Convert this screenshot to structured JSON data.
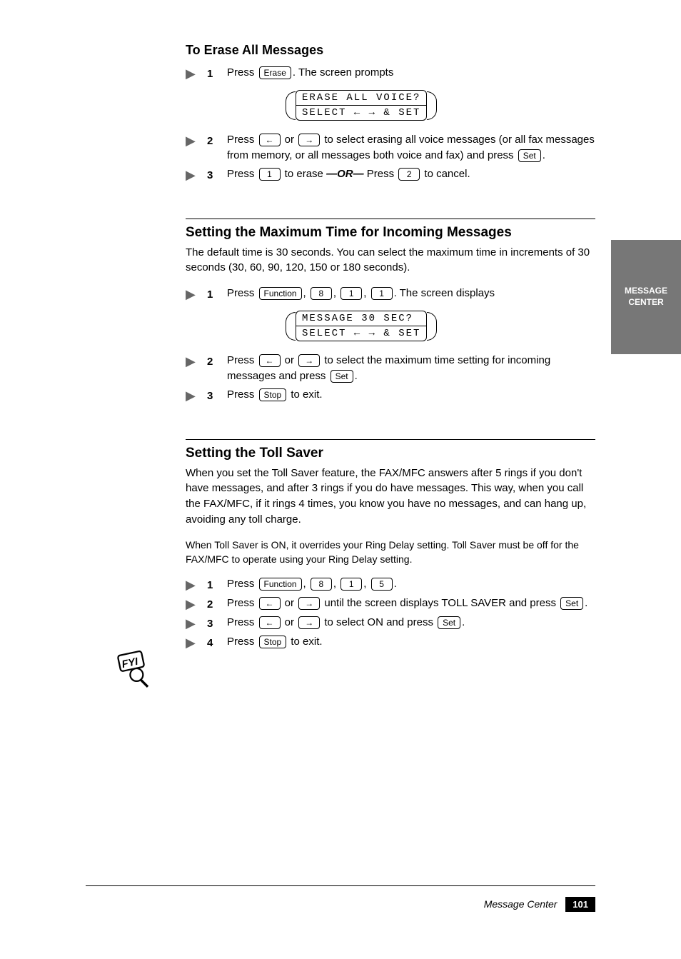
{
  "sideTab": "MESSAGE CENTER",
  "eraseAll": {
    "title": "To Erase All Messages",
    "step1": {
      "text_a": "Press ",
      "key1": "Erase",
      "text_b": ". The screen prompts"
    },
    "lcd": {
      "line1": "ERASE ALL VOICE?",
      "line2": "SELECT ← → & SET"
    },
    "step2": {
      "text_a": "Press ",
      "text_b": " or ",
      "text_c": " to select erasing all voice messages (or all fax messages from memory, or all messages both voice and fax) and press ",
      "key_set": "Set",
      "text_d": "."
    },
    "step3": {
      "text_a": "Press ",
      "key1": "1",
      "text_b": " to erase ",
      "or": "—OR—",
      "text_c": " Press ",
      "key2": "2",
      "text_d": " to cancel."
    }
  },
  "maxTime": {
    "title": "Setting the Maximum Time for Incoming Messages",
    "intro": "The default time is 30 seconds. You can select the maximum time in increments of 30 seconds (30, 60, 90, 120, 150 or 180 seconds).",
    "step1": {
      "text_a": "Press ",
      "key_fn": "Function",
      "key_8": "8",
      "key_1a": "1",
      "key_1b": "1",
      "text_b": ". The screen displays"
    },
    "lcd": {
      "line1": "MESSAGE 30 SEC?",
      "line2": "SELECT ← → & SET"
    },
    "step2": {
      "text_a": "Press ",
      "text_b": " or ",
      "text_c": " to select the maximum time setting for incoming messages and press ",
      "key_set": "Set",
      "text_d": "."
    },
    "step3": {
      "text_a": "Press ",
      "key_stop": "Stop",
      "text_b": " to exit."
    }
  },
  "tollSaver": {
    "title": "Setting the Toll Saver",
    "intro1": "When you set the Toll Saver feature, the FAX/MFC answers after 5 rings if you don't have messages, and after 3 rings if you do have messages. This way, when you call the FAX/MFC, if it rings 4 times, you know you have no messages, and can hang up, avoiding any toll charge.",
    "intro2": "When Toll Saver is ON, it overrides your Ring Delay setting. Toll Saver must be off for the FAX/MFC to operate using your Ring Delay setting.",
    "step1": {
      "text_a": "Press ",
      "key_fn": "Function",
      "key_8": "8",
      "key_1": "1",
      "key_5": "5",
      "text_b": "."
    },
    "step2": {
      "text_a": "Press ",
      "text_b": " or ",
      "text_c": " until the screen displays TOLL SAVER and press ",
      "key_set": "Set",
      "text_d": "."
    },
    "step3": {
      "text_a": "Press ",
      "text_b": " or ",
      "text_c": " to select ON and press ",
      "key_set": "Set",
      "text_d": "."
    },
    "step4": {
      "text_a": "Press ",
      "key_stop": "Stop",
      "text_b": " to exit."
    }
  },
  "footer": {
    "label": "Message Center",
    "page": "101"
  }
}
